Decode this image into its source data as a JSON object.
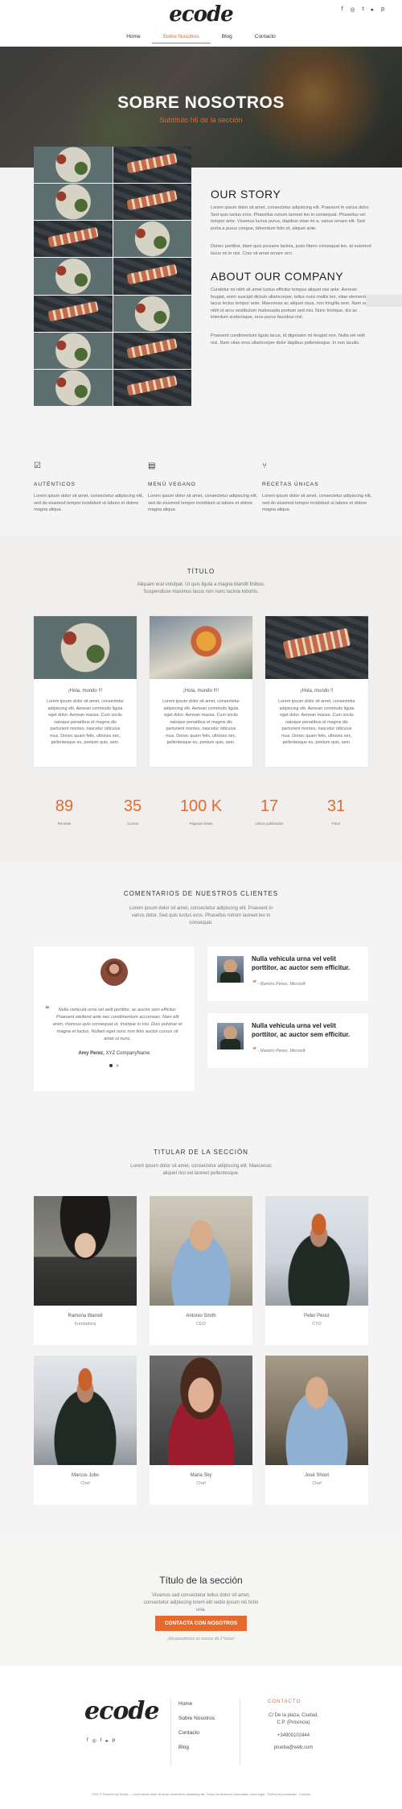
{
  "header": {
    "logo": "ecode",
    "social": [
      "f",
      "◎",
      "t",
      "▸",
      "p"
    ],
    "nav": [
      "Home",
      "Sobre Nosotros",
      "Blog",
      "Contacto"
    ]
  },
  "hero": {
    "title": "SOBRE NOSOTROS",
    "subtitle": "Subtítulo h6 de la sección"
  },
  "story": {
    "title": "OUR STORY",
    "p1": "Lorem ipsum dolor sit amet, consectetur adipiscing elit. Praesent in varius dolor. Sed quis luctus eros. Phasellus rutrum laoreet leo in consequat. Phasellus vel tempor ante. Vivamus luctus purus, dapibus vitae mi a, varius ornare elit. Sed porta a purus congue, bibendum felis et, aliquet ante.",
    "p2": "Donec porttitor, diam quis posuere lacinia, justo libero consequat leo, at euismod lacus mi in nisi. Cras sit amet ornare orci.",
    "company_title": "ABOUT OUR COMPANY",
    "p3": "Curabitur mi nibh sit amet luctus efficitur tempus aliquet nisi ante. Aenean feugiat, enim suscipit dictum ullamcorper, tellus nunc mollis leo, vitae elementum lacus lectus tempor ante. Maecenas ac aliquet risus, non fringilla sem. Nam sed nibh id arcu vestibulum malesuada pretium sed nisi. Nunc tristique, dui ac interdum scelerisque, eros purus faucibus nisl.",
    "p4": "Praesent condimentum ligula lacus, id dignissim mi feugiat non. Nulla vel velit nisi. Nam vitae eros ullamcorper dolor dapibus pellentesque. In non iaculis."
  },
  "features": [
    {
      "icon": "☑",
      "title": "AUTÉNTICOS",
      "text": "Lorem ipsum dolor sit amet, consectetur adipiscing elit, sed do eiusmod tempor incididunt ut labore et dolore magna aliqua."
    },
    {
      "icon": "▤",
      "title": "MENÚ VEGANO",
      "text": "Lorem ipsum dolor sit amet, consectetur adipiscing elit, sed do eiusmod tempor incididunt ut labore et dolore magna aliqua."
    },
    {
      "icon": "⑂",
      "title": "RECETAS ÚNICAS",
      "text": "Lorem ipsum dolor sit amet, consectetur adipiscing elit, sed do eiusmod tempor incididunt ut labore et dolore magna aliqua."
    }
  ],
  "blog": {
    "title": "TÍTULO",
    "desc": "Aliquam erat volutpat. Ut quis ligula a magna blandit finibus. Suspendisse maximus lacus non nunc lacinia lobortis.",
    "cards": [
      {
        "title": "¡Hola, mundo !!!",
        "text": "Lorem ipsum dolor sit amet, consectetur adipiscing elit. Aenean commodo ligula eget dolor. Aenean massa. Cum sociis natoque penatibus et magnis dis parturient montes, nascetur ridiculus mus. Donec quam felis, ultricies nec, pellentesque eu, pretium quis, sem."
      },
      {
        "title": "¡Hola, mundo !!!!",
        "text": "Lorem ipsum dolor sit amet, consectetur adipiscing elit. Aenean commodo ligula eget dolor. Aenean massa. Cum sociis natoque penatibus et magnis dis parturient montes, nascetur ridiculus mus. Donec quam felis, ultricies nec, pellentesque eu, pretium quis, sem."
      },
      {
        "title": "¡Hola, mundo !!",
        "text": "Lorem ipsum dolor sit amet, consectetur adipiscing elit. Aenean commodo ligula eget dolor. Aenean massa. Cum sociis natoque penatibus et magnis dis parturient montes, nascetur ridiculus mus. Donec quam felis, ultricies nec, pellentesque eu, pretium quis, sem."
      }
    ]
  },
  "counters": [
    {
      "num": "89",
      "label": "Recetas"
    },
    {
      "num": "35",
      "label": "Cursos"
    },
    {
      "num": "100 K",
      "label": "Páginas vistas"
    },
    {
      "num": "17",
      "label": "Libros publicados"
    },
    {
      "num": "31",
      "label": "Fans"
    }
  ],
  "testimonials": {
    "title": "COMENTARIOS DE NUESTROS CLIENTES",
    "desc": "Lorem ipsum dolor sit amet, consectetur adipiscing elit. Praesent in varius dolor. Sed quis luctus eros. Phasellus rutrum laoreet leo in consequat.",
    "main_quote": "Nulla vehicula urna vel velit porttitor, ac auctor sem efficitur. Praesent eleifend ante nec condimentum accumsan. Nam elit enim, rhoncus quis consequat ut, tristique in nisi. Duis pulvinar et magna et luctus. Nullam eget nunc non felis auctor cursus sit amet ut nunc.",
    "main_author": "Amy Perez,",
    "main_company": "XYZ CompanyName",
    "side": [
      {
        "quote": "Nulla vehicula urna vel velit porttitor, ac auctor sem efficitur.",
        "author": "- Ramiro Perez, Microsft"
      },
      {
        "quote": "Nulla vehicula urna vel velit porttitor, ac auctor sem efficitur.",
        "author": "- Ramiro Perez, Microsft"
      }
    ]
  },
  "team": {
    "title": "TITULAR DE LA SECCIÓN",
    "desc": "Lorem ipsum dolor sit amet, consectetur adipiscing elit. Maecenas aliquet nisl vel laoreet pellentesque.",
    "members": [
      {
        "name": "Ramona Warrell",
        "role": "Fundadora"
      },
      {
        "name": "Antonio Smith",
        "role": "CEO"
      },
      {
        "name": "Peter Pérez",
        "role": "CTO"
      },
      {
        "name": "Marcos Jobs",
        "role": "Chef"
      },
      {
        "name": "Maria Sky",
        "role": "Chef"
      },
      {
        "name": "José Shoot",
        "role": "Chef"
      }
    ]
  },
  "cta": {
    "title": "Título de la sección",
    "desc": "Vivamus sed consectetur tellus dolor sit amet, consectetur adipiscing lorem elit sedio ipsum nis tictio una.",
    "button": "CONTACTA CON NOSOTROS",
    "note": "¡Respondemos en menos de 2 horas!"
  },
  "footer": {
    "logo": "ecode",
    "links": [
      "Home",
      "Sobre Nosotros",
      "Contacto",
      "Blog"
    ],
    "contact_title": "CONTACTO",
    "address": "C/ De la plaza, Ciudad, C.P. (Provincia)",
    "phone": "+34900102444",
    "email": "prueba@web.com",
    "copyright": "2021 © Powered by Ecode — lorem ipsum dolor sit amet consectetur adipiscing elit. Todos los derechos reservados. Aviso legal · Política de privacidad · Cookies"
  }
}
